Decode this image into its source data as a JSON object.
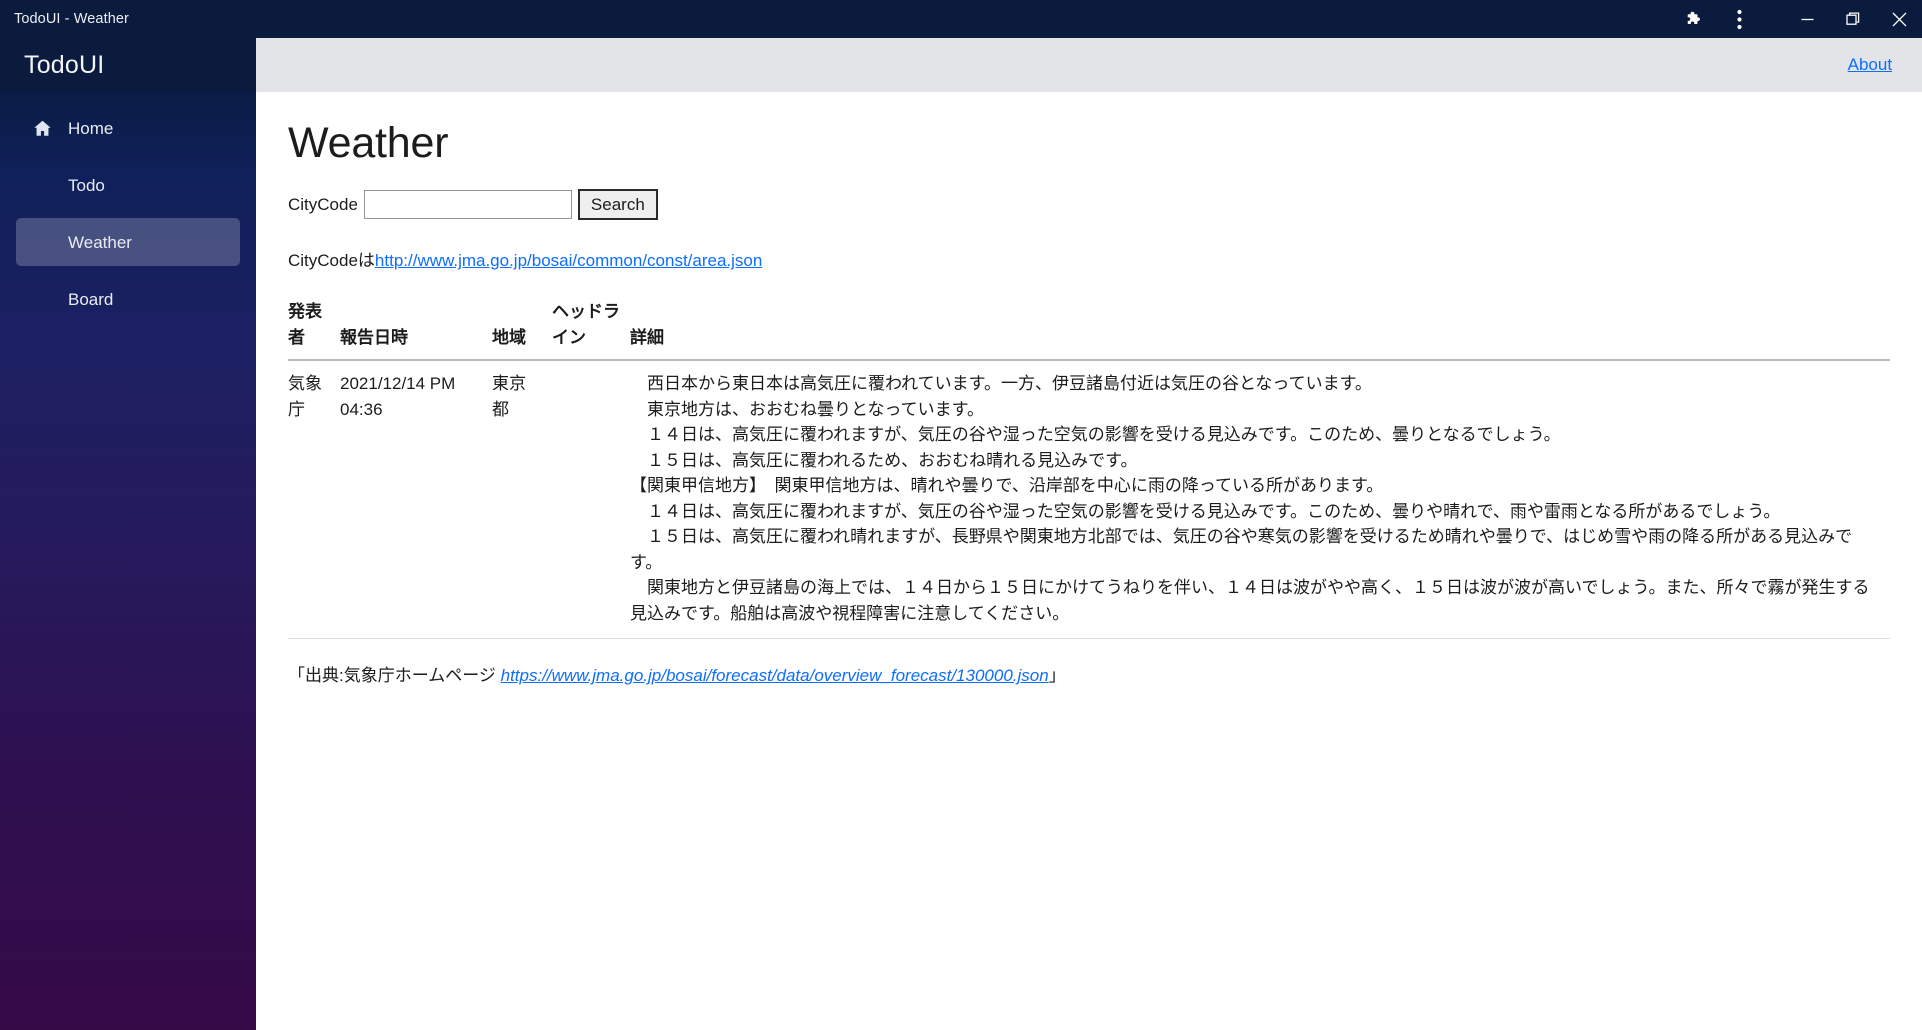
{
  "window": {
    "title": "TodoUI - Weather",
    "controls": {
      "extensions": "puzzle-piece-icon",
      "menu": "three-dots-vertical-icon",
      "minimize": "minimize-icon",
      "maximize": "maximize-icon",
      "close": "close-icon"
    }
  },
  "sidebar": {
    "brand": "TodoUI",
    "items": [
      {
        "label": "Home",
        "icon": "home-icon",
        "active": false
      },
      {
        "label": "Todo",
        "icon": "",
        "active": false
      },
      {
        "label": "Weather",
        "icon": "",
        "active": true
      },
      {
        "label": "Board",
        "icon": "",
        "active": false
      }
    ]
  },
  "topbar": {
    "about_label": "About"
  },
  "page": {
    "title": "Weather",
    "search": {
      "label": "CityCode",
      "value": "",
      "placeholder": "",
      "button_label": "Search"
    },
    "source_line": {
      "prefix": "CityCodeは",
      "link_text": "http://www.jma.go.jp/bosai/common/const/area.json"
    }
  },
  "table": {
    "headers": [
      "発表者",
      "報告日時",
      "地域",
      "ヘッドライン",
      "詳細"
    ],
    "rows": [
      {
        "publisher": "気象庁",
        "datetime": "2021/12/14 PM 04:36",
        "area": "東京都",
        "headline": "",
        "detail": "　西日本から東日本は高気圧に覆われています。一方、伊豆諸島付近は気圧の谷となっています。\n　東京地方は、おおむね曇りとなっています。\n　１４日は、高気圧に覆われますが、気圧の谷や湿った空気の影響を受ける見込みです。このため、曇りとなるでしょう。\n　１５日は、高気圧に覆われるため、おおむね晴れる見込みです。\n【関東甲信地方】　関東甲信地方は、晴れや曇りで、沿岸部を中心に雨の降っている所があります。\n　１４日は、高気圧に覆われますが、気圧の谷や湿った空気の影響を受ける見込みです。このため、曇りや晴れで、雨や雷雨となる所があるでしょう。\n　１５日は、高気圧に覆われ晴れますが、長野県や関東地方北部では、気圧の谷や寒気の影響を受けるため晴れや曇りで、はじめ雪や雨の降る所がある見込みです。\n　関東地方と伊豆諸島の海上では、１４日から１５日にかけてうねりを伴い、１４日は波がやや高く、１５日は波が波が高いでしょう。また、所々で霧が発生する見込みです。船舶は高波や視程障害に注意してください。"
      }
    ]
  },
  "footer": {
    "prefix": "「出典:気象庁ホームページ ",
    "link_text": "https://www.jma.go.jp/bosai/forecast/data/overview_forecast/130000.json",
    "suffix": "」"
  },
  "colors": {
    "titlebar": "#0a1b3d",
    "sidebar_top": "#071a38",
    "sidebar_bottom": "#350a47",
    "topbar": "#e2e4e8",
    "link": "#0d6efd",
    "active_nav": "rgba(255,255,255,0.22)"
  }
}
